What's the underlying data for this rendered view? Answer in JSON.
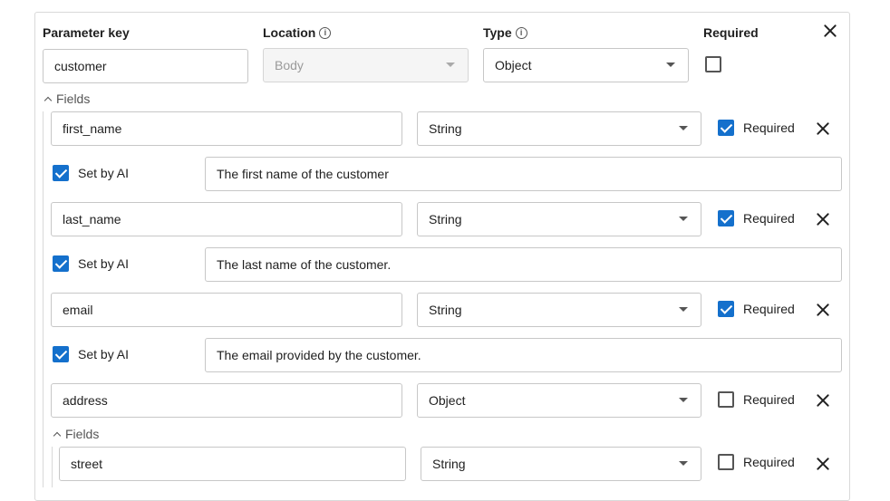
{
  "header": {
    "parameter_key_label": "Parameter key",
    "location_label": "Location",
    "type_label": "Type",
    "required_label": "Required"
  },
  "param": {
    "key": "customer",
    "location": "Body",
    "type": "Object",
    "required": false
  },
  "fields_label": "Fields",
  "fields": [
    {
      "name": "first_name",
      "type": "String",
      "required": true,
      "required_label": "Required",
      "set_by_ai": true,
      "set_by_ai_label": "Set by AI",
      "description": "The first name of the customer"
    },
    {
      "name": "last_name",
      "type": "String",
      "required": true,
      "required_label": "Required",
      "set_by_ai": true,
      "set_by_ai_label": "Set by AI",
      "description": "The last name of the customer."
    },
    {
      "name": "email",
      "type": "String",
      "required": true,
      "required_label": "Required",
      "set_by_ai": true,
      "set_by_ai_label": "Set by AI",
      "description": "The email provided by the customer."
    },
    {
      "name": "address",
      "type": "Object",
      "required": false,
      "required_label": "Required"
    }
  ],
  "nested": {
    "fields_label": "Fields",
    "fields": [
      {
        "name": "street",
        "type": "String",
        "required": false,
        "required_label": "Required"
      }
    ]
  },
  "icons": {
    "info": "info-icon",
    "close": "close-icon",
    "caret": "caret-down-icon",
    "collapse": "chevron-up-icon"
  },
  "colors": {
    "checkbox_checked": "#1470cc",
    "border": "#c7c7c7",
    "disabled_bg": "#f5f5f5"
  }
}
